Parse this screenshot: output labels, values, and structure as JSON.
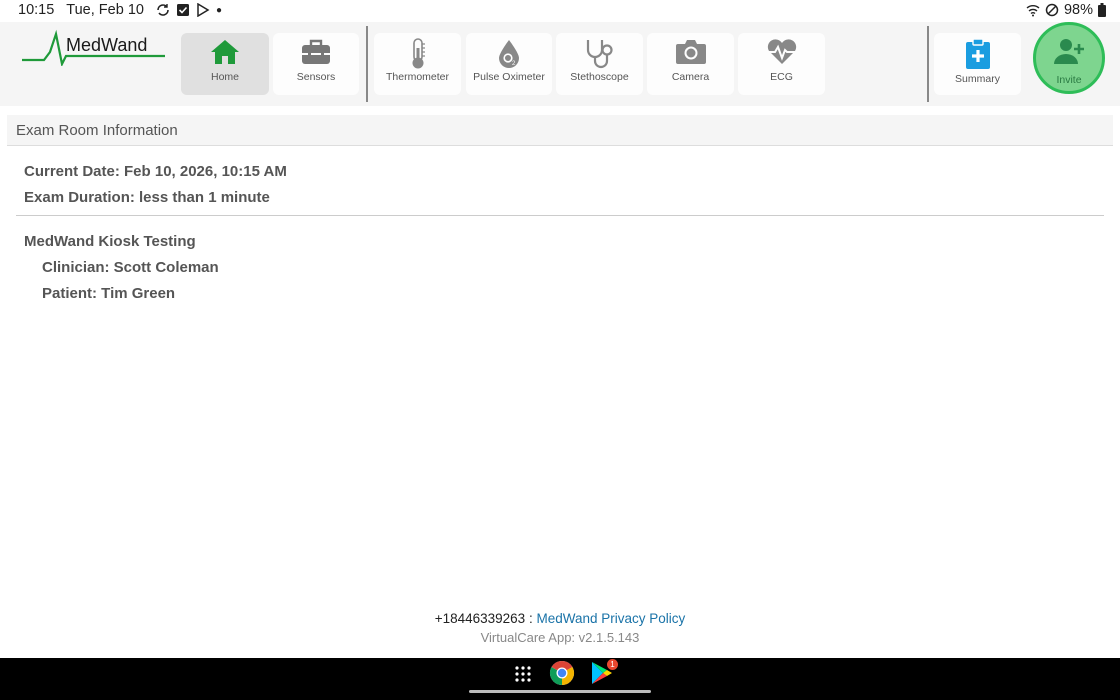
{
  "status_bar": {
    "time": "10:15",
    "date": "Tue, Feb 10",
    "battery": "98%",
    "icons_left": [
      "sync-icon",
      "checkbox-icon",
      "play-store-icon",
      "dot-icon"
    ],
    "icons_right": [
      "wifi-icon",
      "do-not-disturb-icon",
      "battery-icon"
    ]
  },
  "logo": {
    "text": "MedWand"
  },
  "nav": {
    "home": "Home",
    "sensors": "Sensors",
    "thermometer": "Thermometer",
    "pulse_oximeter": "Pulse Oximeter",
    "stethoscope": "Stethoscope",
    "camera": "Camera",
    "ecg": "ECG",
    "summary": "Summary",
    "invite": "Invite"
  },
  "section": {
    "title": "Exam Room Information"
  },
  "info": {
    "current_date": "Current Date: Feb 10, 2026, 10:15 AM",
    "exam_duration": "Exam Duration: less than 1 minute",
    "room_name": "MedWand Kiosk Testing",
    "clinician": "Clinician: Scott Coleman",
    "patient": "Patient: Tim Green"
  },
  "footer": {
    "phone": "+18446339263 :",
    "privacy_link": "MedWand Privacy Policy",
    "version": "VirtualCare App: v2.1.5.143"
  },
  "taskbar": {
    "play_badge": "1"
  },
  "colors": {
    "brand_green": "#1f9a3a",
    "accent_blue": "#1a9de0",
    "invite_green": "#7ed58f"
  }
}
